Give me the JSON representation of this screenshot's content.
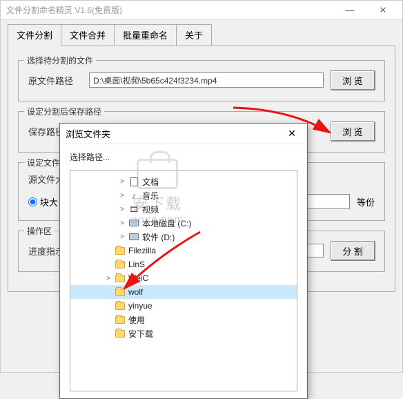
{
  "window": {
    "title": "文件分割命名精灵 V1.6(免费版)"
  },
  "tabs": [
    "文件分割",
    "文件合并",
    "批量重命名",
    "关于"
  ],
  "group1": {
    "title": "选择待分割的文件",
    "label": "原文件路径",
    "value": "D:\\桌面\\视频\\5b65c424f3234.mp4",
    "browse": "浏 览"
  },
  "group2": {
    "title": "设定分割后保存路径",
    "label": "保存路径",
    "browse": "浏 览"
  },
  "group3": {
    "title": "设定文件分",
    "label": "源文件大",
    "radio": "块大",
    "unit": "等份"
  },
  "group4": {
    "title": "操作区",
    "label": "进度指示",
    "split": "分 割"
  },
  "dialog": {
    "title": "浏览文件夹",
    "prompt": "选择路径...",
    "items": [
      {
        "label": "文档",
        "icon": "doc",
        "expander": ">",
        "depth": 2
      },
      {
        "label": "音乐",
        "icon": "music",
        "expander": ">",
        "depth": 2
      },
      {
        "label": "视频",
        "icon": "video",
        "expander": ">",
        "depth": 2
      },
      {
        "label": "本地磁盘 (C:)",
        "icon": "drive",
        "expander": ">",
        "depth": 2
      },
      {
        "label": "软件 (D:)",
        "icon": "drive",
        "expander": ">",
        "depth": 2
      },
      {
        "label": "Filezilla",
        "icon": "folder",
        "expander": "",
        "depth": 1
      },
      {
        "label": "LinS",
        "icon": "folder",
        "expander": "",
        "depth": 1
      },
      {
        "label": "WeiC",
        "icon": "folder",
        "expander": ">",
        "depth": 1
      },
      {
        "label": "wolf",
        "icon": "folder",
        "expander": "",
        "depth": 1,
        "selected": true
      },
      {
        "label": "yinyue",
        "icon": "folder",
        "expander": "",
        "depth": 1
      },
      {
        "label": "使用",
        "icon": "folder",
        "expander": "",
        "depth": 1
      },
      {
        "label": "安下载",
        "icon": "folder",
        "expander": "",
        "depth": 1
      }
    ]
  },
  "watermark": {
    "line1": "安下载",
    "line2": "anxz.com"
  }
}
